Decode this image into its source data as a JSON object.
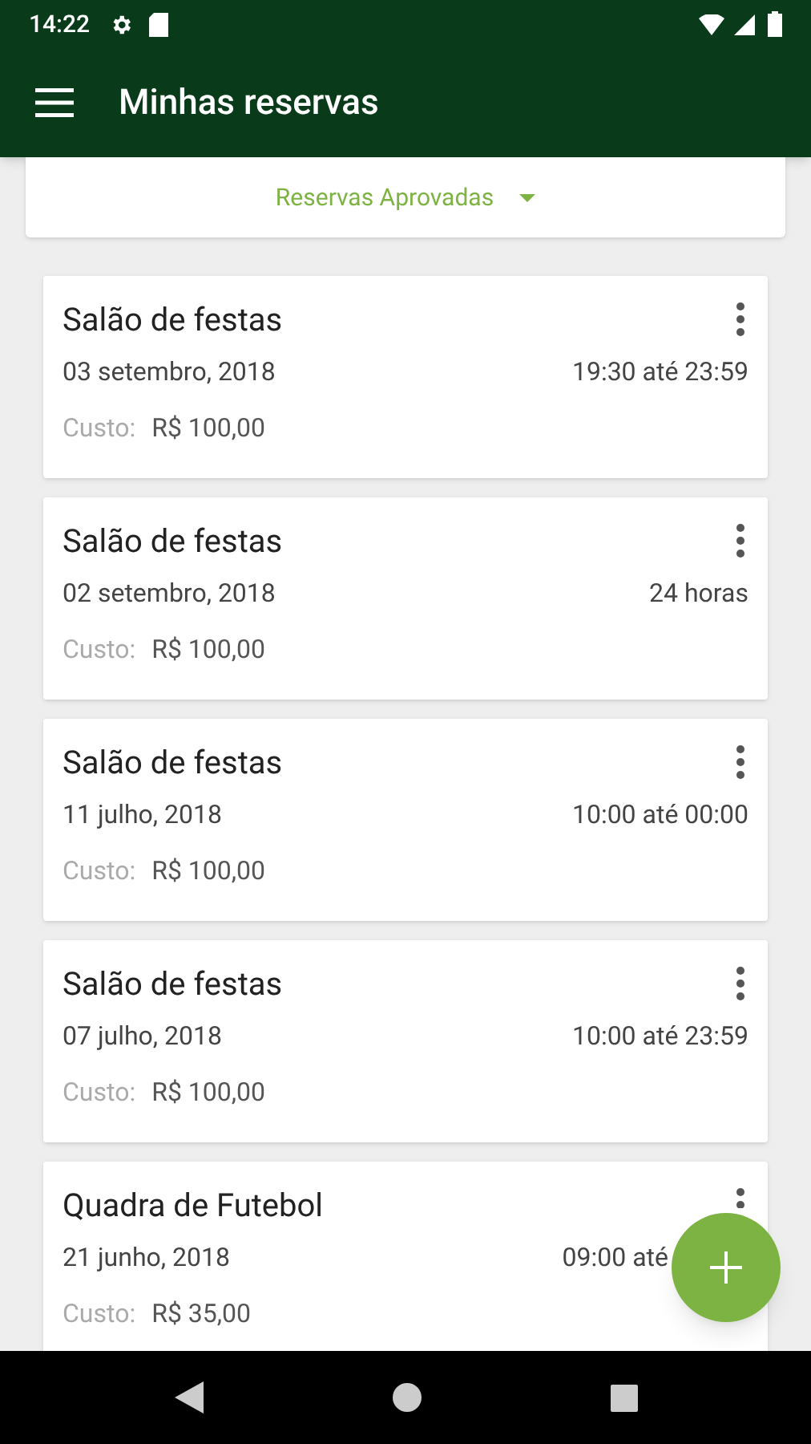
{
  "status_bar": {
    "time": "14:22"
  },
  "app_bar": {
    "title": "Minhas reservas"
  },
  "filter": {
    "label": "Reservas Aprovadas"
  },
  "reservations": [
    {
      "title": "Salão de festas",
      "date": "03 setembro, 2018",
      "time": "19:30 até 23:59",
      "cost_label": "Custo:",
      "cost": "R$ 100,00"
    },
    {
      "title": "Salão de festas",
      "date": "02 setembro, 2018",
      "time": "24 horas",
      "cost_label": "Custo:",
      "cost": "R$ 100,00"
    },
    {
      "title": "Salão de festas",
      "date": "11 julho, 2018",
      "time": "10:00 até 00:00",
      "cost_label": "Custo:",
      "cost": "R$ 100,00"
    },
    {
      "title": "Salão de festas",
      "date": "07 julho, 2018",
      "time": "10:00 até 23:59",
      "cost_label": "Custo:",
      "cost": "R$ 100,00"
    },
    {
      "title": "Quadra de Futebol",
      "date": "21 junho, 2018",
      "time": "09:00 até",
      "cost_label": "Custo:",
      "cost": "R$ 35,00"
    }
  ]
}
